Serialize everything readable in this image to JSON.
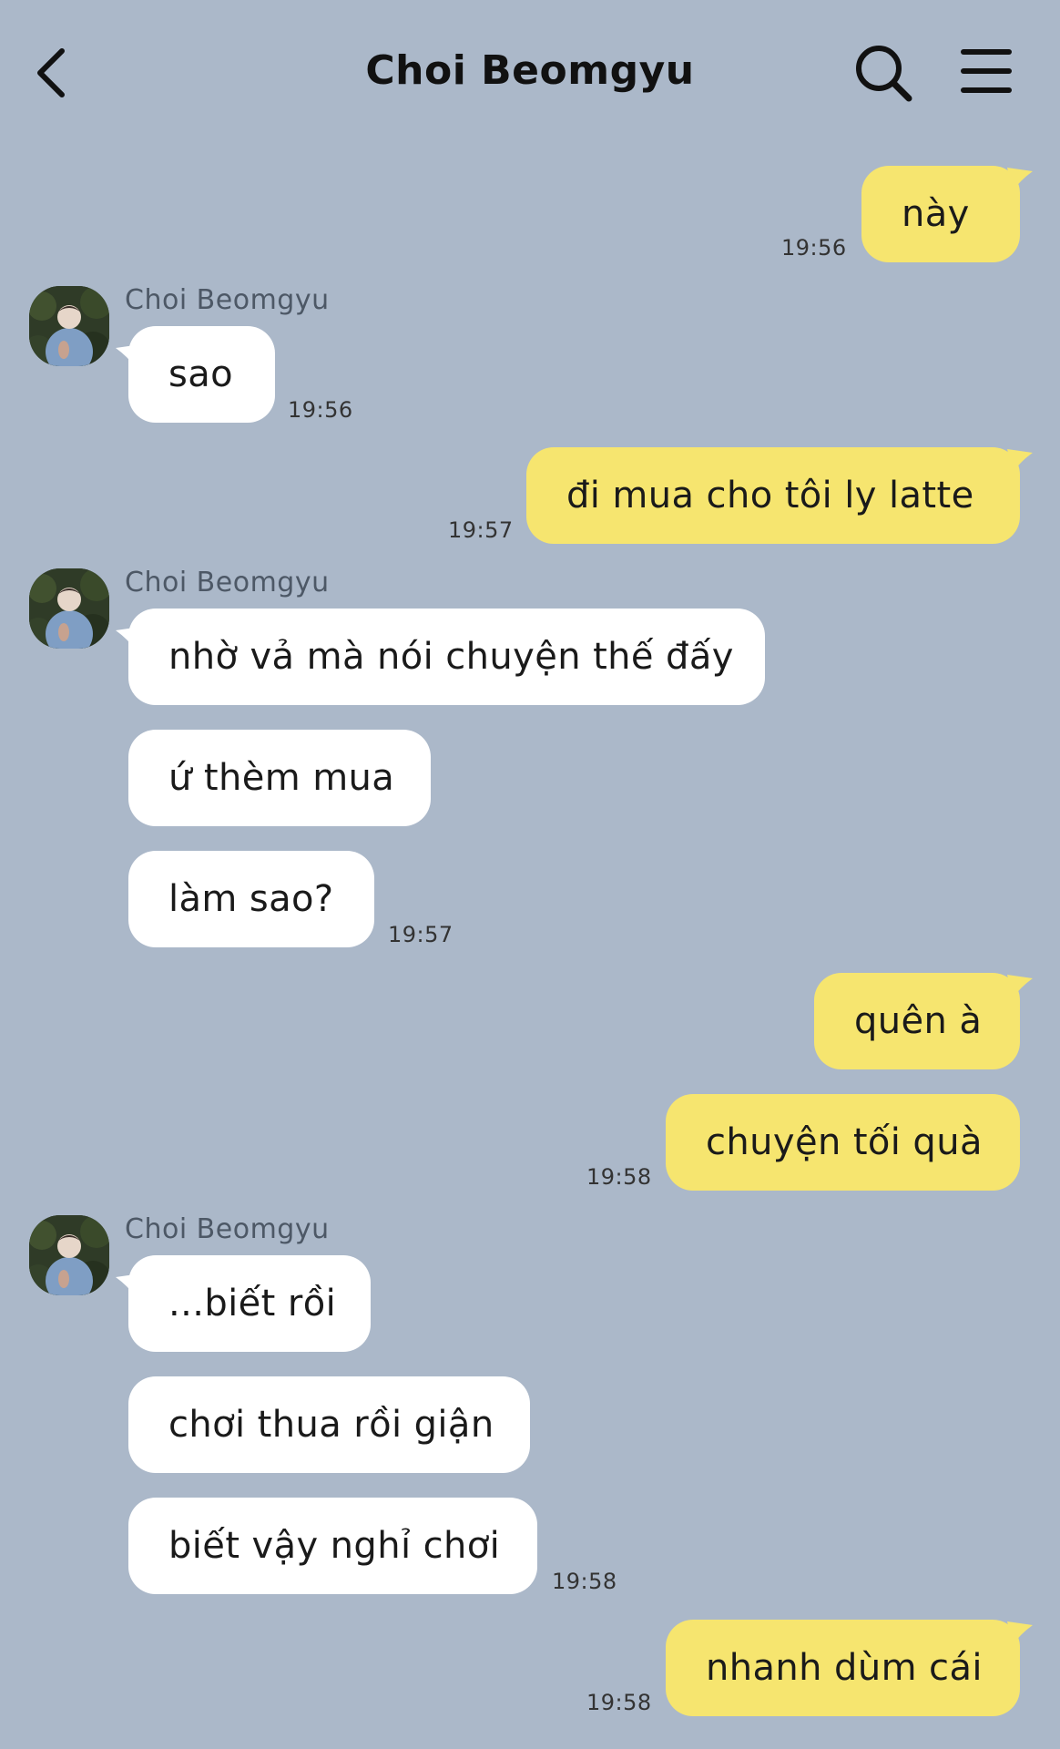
{
  "header": {
    "title": "Choi Beomgyu",
    "back_icon": "chevron-left-icon",
    "search_icon": "search-icon",
    "menu_icon": "hamburger-menu-icon"
  },
  "colors": {
    "background": "#abb8c9",
    "my_bubble": "#f6e56f",
    "their_bubble": "#ffffff"
  },
  "messages": [
    {
      "from": "me",
      "text": "này",
      "time": "19:56"
    },
    {
      "from": "them",
      "sender": "Choi Beomgyu",
      "text": "sao",
      "time": "19:56"
    },
    {
      "from": "me",
      "text": "đi mua cho tôi ly latte",
      "time": "19:57"
    },
    {
      "from": "them",
      "sender": "Choi Beomgyu",
      "text": "nhờ vả mà nói chuyện thế đấy"
    },
    {
      "from": "them",
      "text": "ứ thèm mua"
    },
    {
      "from": "them",
      "text": "làm sao?",
      "time": "19:57"
    },
    {
      "from": "me",
      "text": "quên à"
    },
    {
      "from": "me",
      "text": "chuyện tối quà",
      "time": "19:58"
    },
    {
      "from": "them",
      "sender": "Choi Beomgyu",
      "text": "...biết rồi"
    },
    {
      "from": "them",
      "text": "chơi thua rồi giận"
    },
    {
      "from": "them",
      "text": "biết vậy nghỉ chơi",
      "time": "19:58"
    },
    {
      "from": "me",
      "text": "nhanh dùm cái",
      "time": "19:58"
    }
  ]
}
